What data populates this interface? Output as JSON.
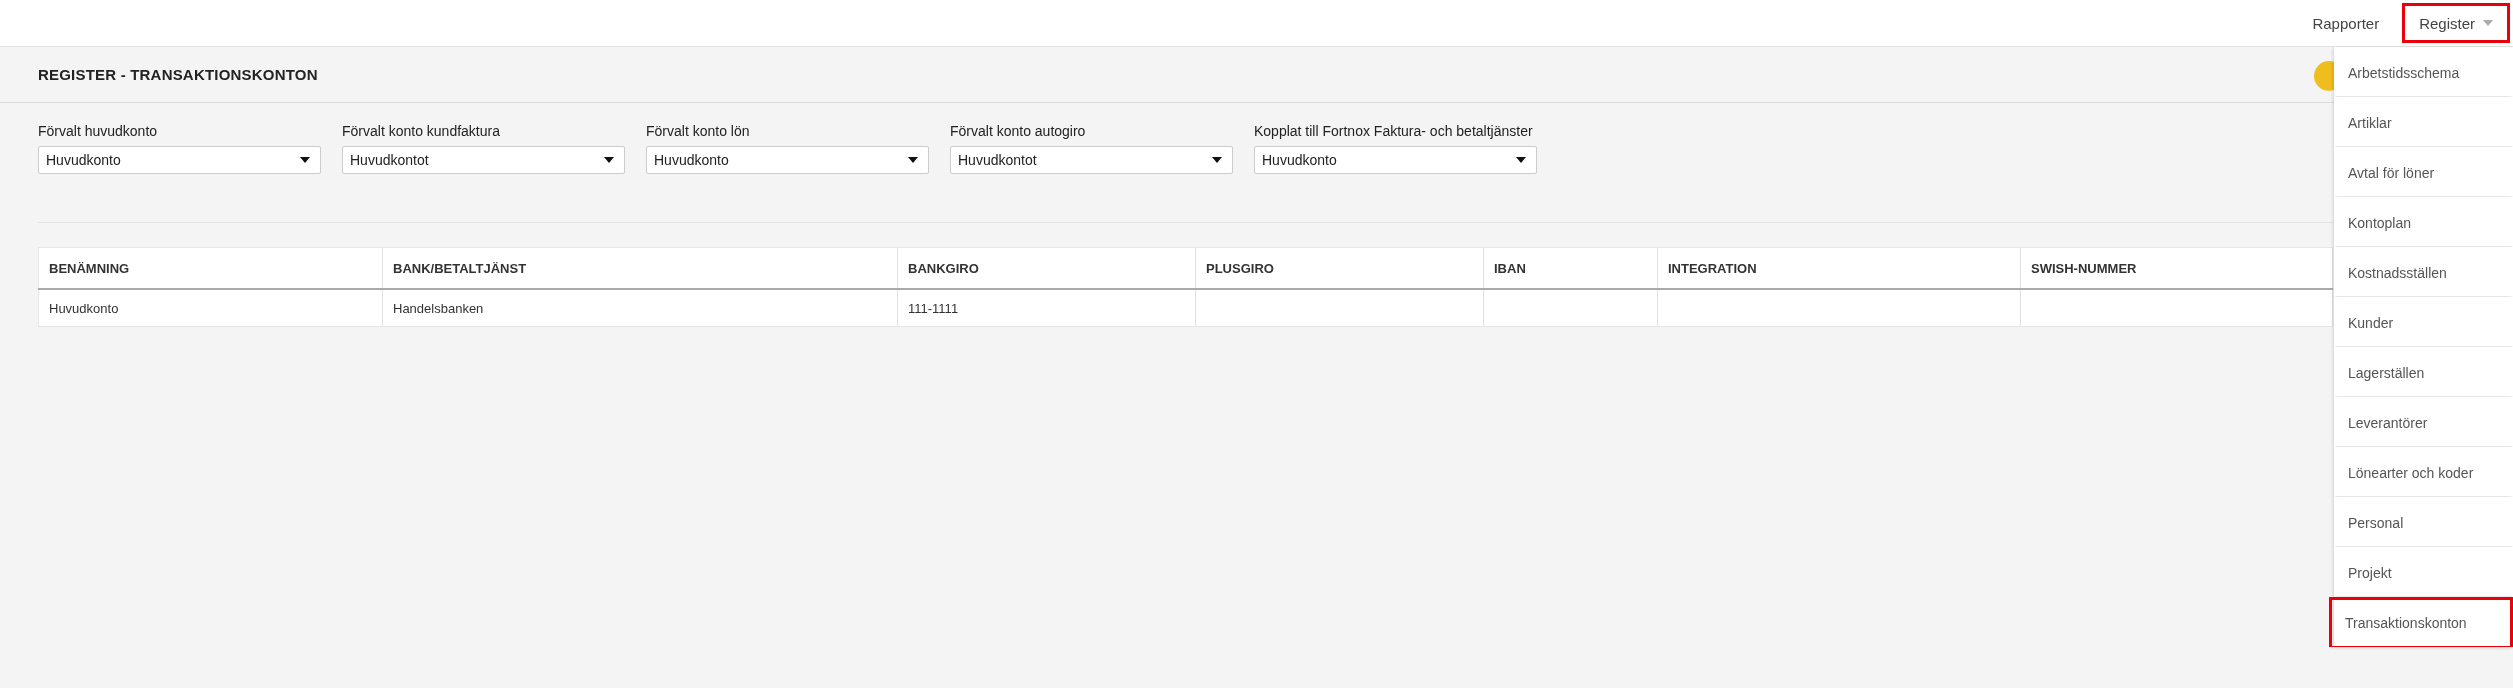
{
  "top_nav": [
    {
      "label": "Rapporter",
      "kind": "link",
      "highlighted": false
    },
    {
      "label": "Register",
      "kind": "dropdown",
      "highlighted": true
    }
  ],
  "page_title": "REGISTER - TRANSAKTIONSKONTON",
  "filters": [
    {
      "label": "Förvalt huvudkonto",
      "value": "Huvudkonto"
    },
    {
      "label": "Förvalt konto kundfaktura",
      "value": "Huvudkontot"
    },
    {
      "label": "Förvalt konto lön",
      "value": "Huvudkonto"
    },
    {
      "label": "Förvalt konto autogiro",
      "value": "Huvudkontot"
    },
    {
      "label": "Kopplat till Fortnox Faktura- och betaltjänster",
      "value": "Huvudkonto"
    }
  ],
  "table": {
    "columns": [
      "BENÄMNING",
      "BANK/BETALTJÄNST",
      "BANKGIRO",
      "PLUSGIRO",
      "IBAN",
      "INTEGRATION",
      "SWISH-NUMMER"
    ],
    "rows": [
      [
        "Huvudkonto",
        "Handelsbanken",
        "111-1111",
        "",
        "",
        "",
        ""
      ]
    ]
  },
  "dropdown_menu": [
    {
      "label": "Arbetstidsschema",
      "highlighted": false
    },
    {
      "label": "Artiklar",
      "highlighted": false
    },
    {
      "label": "Avtal för löner",
      "highlighted": false
    },
    {
      "label": "Kontoplan",
      "highlighted": false
    },
    {
      "label": "Kostnadsställen",
      "highlighted": false
    },
    {
      "label": "Kunder",
      "highlighted": false
    },
    {
      "label": "Lagerställen",
      "highlighted": false
    },
    {
      "label": "Leverantörer",
      "highlighted": false
    },
    {
      "label": "Lönearter och koder",
      "highlighted": false
    },
    {
      "label": "Personal",
      "highlighted": false
    },
    {
      "label": "Projekt",
      "highlighted": false
    },
    {
      "label": "Transaktionskonton",
      "highlighted": true
    }
  ]
}
